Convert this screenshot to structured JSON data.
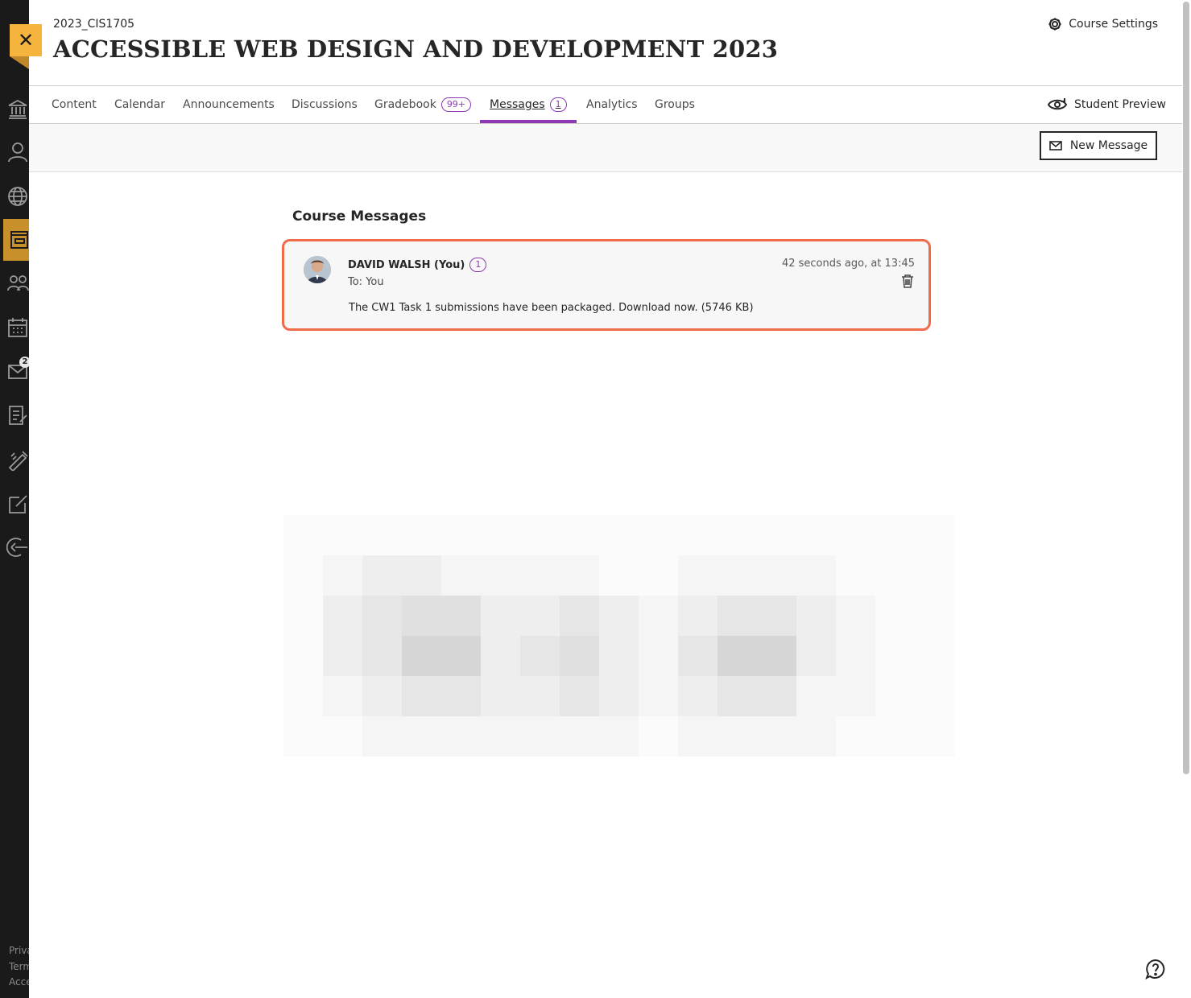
{
  "rail": {
    "items": [
      {
        "name": "institution-icon"
      },
      {
        "name": "profile-icon"
      },
      {
        "name": "globe-icon"
      },
      {
        "name": "courses-icon"
      },
      {
        "name": "organizations-icon"
      },
      {
        "name": "calendar-icon"
      },
      {
        "name": "messages-icon"
      },
      {
        "name": "grades-icon"
      },
      {
        "name": "tools-icon"
      },
      {
        "name": "edit-icon"
      },
      {
        "name": "sign-out-icon"
      }
    ],
    "messages_badge": "2",
    "footer": [
      "Priva",
      "Term",
      "Acce"
    ]
  },
  "course": {
    "code": "2023_CIS1705",
    "title": "ACCESSIBLE WEB DESIGN AND DEVELOPMENT 2023",
    "settings_label": "Course Settings"
  },
  "tabs": [
    {
      "label": "Content"
    },
    {
      "label": "Calendar"
    },
    {
      "label": "Announcements"
    },
    {
      "label": "Discussions"
    },
    {
      "label": "Gradebook",
      "badge": "99+"
    },
    {
      "label": "Messages",
      "badge": "1",
      "active": true
    },
    {
      "label": "Analytics"
    },
    {
      "label": "Groups"
    }
  ],
  "student_preview_label": "Student Preview",
  "new_message_label": "New Message",
  "section_title": "Course Messages",
  "message": {
    "sender": "DAVID WALSH (You)",
    "unread_count": "1",
    "to": "To: You",
    "timestamp": "42 seconds ago, at 13:45",
    "body": "The CW1 Task 1 submissions have been packaged. Download now. (5746 KB)"
  },
  "colors": {
    "accent": "#8e3ab5",
    "highlight_border": "#f06b4a",
    "rail_bg": "#1a1a1a",
    "close_tab": "#f4b43d"
  }
}
